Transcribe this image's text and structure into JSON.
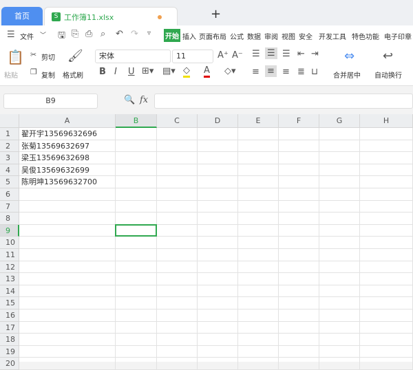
{
  "tabs": {
    "home": "首页",
    "doc": "工作簿11.xlsx",
    "doc_icon": "S",
    "add": "+"
  },
  "menu": {
    "file": "文件",
    "items": [
      "开始",
      "插入",
      "页面布局",
      "公式",
      "数据",
      "审阅",
      "视图",
      "安全",
      "开发工具",
      "特色功能",
      "电子印章"
    ],
    "active": "开始",
    "accent": "#2fa84f"
  },
  "toolbar": {
    "paste": "粘贴",
    "cut": "剪切",
    "copy": "复制",
    "format_painter": "格式刷",
    "font": "宋体",
    "font_size": "11",
    "bold": "B",
    "italic": "I",
    "underline": "U",
    "merge": "合并居中",
    "wrap": "自动换行"
  },
  "formula_bar": {
    "name_box": "B9",
    "fx": "fx",
    "value": ""
  },
  "sheet": {
    "columns": [
      "A",
      "B",
      "C",
      "D",
      "E",
      "F",
      "G",
      "H"
    ],
    "rows": [
      "1",
      "2",
      "3",
      "4",
      "5",
      "6",
      "7",
      "8",
      "9",
      "10",
      "11",
      "12",
      "13",
      "14",
      "15",
      "16",
      "17",
      "18",
      "19",
      "20"
    ],
    "cells_a": [
      "翟开宇13569632696",
      "张菊13569632697",
      "梁玉13569632698",
      "吴俊13569632699",
      "陈明坤13569632700"
    ],
    "selected": "B9"
  }
}
